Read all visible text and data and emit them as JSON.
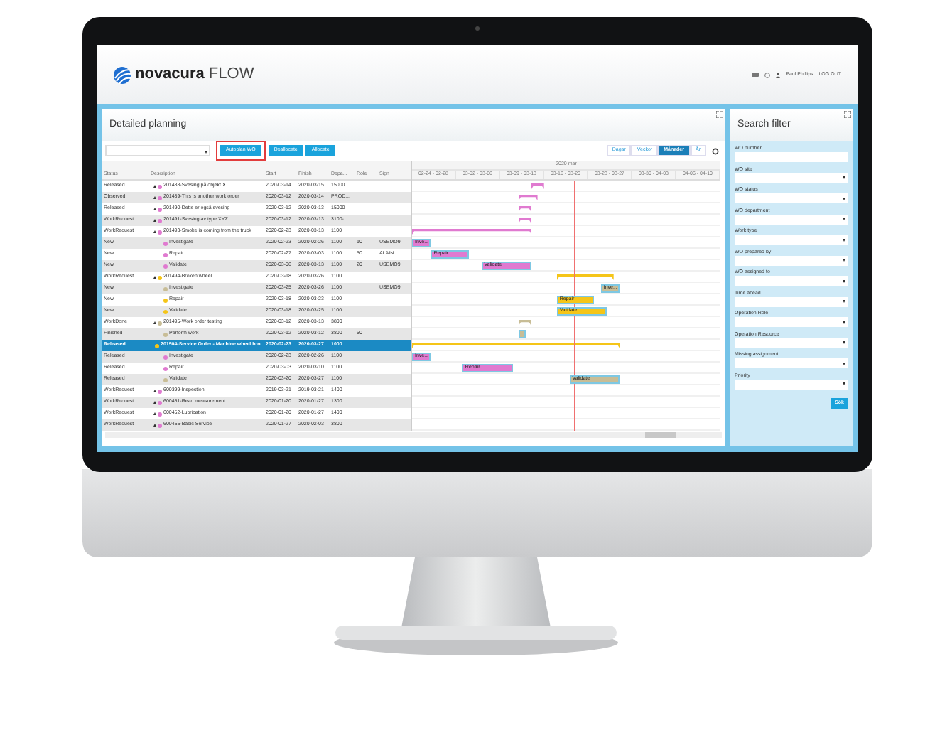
{
  "header": {
    "logo_name": "novacura",
    "logo_product": "FLOW",
    "user": "Paul Phillips",
    "logout": "LOG OUT"
  },
  "planning": {
    "title": "Detailed planning",
    "buttons": [
      {
        "label": "Autoplan WO",
        "highlighted": true
      },
      {
        "label": "Deallocate",
        "highlighted": false
      },
      {
        "label": "Allocate",
        "highlighted": false
      }
    ],
    "view_modes": [
      {
        "label": "Dagar",
        "selected": false
      },
      {
        "label": "Veckor",
        "selected": false
      },
      {
        "label": "Månader",
        "selected": true
      },
      {
        "label": "År",
        "selected": false
      }
    ],
    "columns": [
      "Status",
      "Description",
      "Start",
      "Finish",
      "Depa...",
      "Role",
      "Sign"
    ],
    "rows": [
      {
        "status": "Released",
        "description": "201488-Svesing på objekt X",
        "start": "2020-03-14",
        "finish": "2020-03-15",
        "dept": "15000",
        "color": "#e07ad0",
        "selected": false
      },
      {
        "status": "Observed",
        "description": "201489-This is another work order",
        "start": "2020-03-12",
        "finish": "2020-03-14",
        "dept": "PROD...",
        "color": "#e07ad0",
        "selected": false
      },
      {
        "status": "Released",
        "description": "201490-Dette er også svesing",
        "start": "2020-03-12",
        "finish": "2020-03-13",
        "dept": "15000",
        "color": "#e07ad0",
        "selected": false
      },
      {
        "status": "WorkRequest",
        "description": "201491-Svesing av type XYZ",
        "start": "2020-03-12",
        "finish": "2020-03-13",
        "dept": "3100-...",
        "color": "#e07ad0",
        "selected": false
      },
      {
        "status": "WorkRequest",
        "description": "201493-Smoke is coming from the truck",
        "start": "2020-02-23",
        "finish": "2020-03-13",
        "dept": "1100",
        "color": "#e07ad0",
        "selected": false,
        "children": [
          {
            "status": "New",
            "description": "Investigate",
            "start": "2020-02-23",
            "finish": "2020-02-26",
            "dept": "1100",
            "role": "10",
            "sign": "USEMO9",
            "color": "#e07ad0",
            "bar_label": "Inve...",
            "selected": false
          },
          {
            "status": "New",
            "description": "Repair",
            "start": "2020-02-27",
            "finish": "2020-03-03",
            "dept": "1100",
            "role": "50",
            "sign": "ALAIN",
            "color": "#e07ad0",
            "bar_label": "Repair",
            "selected": false
          },
          {
            "status": "New",
            "description": "Validate",
            "start": "2020-03-06",
            "finish": "2020-03-13",
            "dept": "1100",
            "role": "20",
            "sign": "USEMO9",
            "color": "#e07ad0",
            "bar_label": "Validate",
            "selected": false
          }
        ]
      },
      {
        "status": "WorkRequest",
        "description": "201494-Broken wheel",
        "start": "2020-03-18",
        "finish": "2020-03-26",
        "dept": "1100",
        "color": "#f5c518",
        "selected": false,
        "children": [
          {
            "status": "New",
            "description": "Investigate",
            "start": "2020-03-25",
            "finish": "2020-03-26",
            "dept": "1100",
            "sign": "USEMO9",
            "color": "#c8bd96",
            "bar_label": "Inve...",
            "selected": false
          },
          {
            "status": "New",
            "description": "Repair",
            "start": "2020-03-18",
            "finish": "2020-03-23",
            "dept": "1100",
            "color": "#f5c518",
            "bar_label": "Repair",
            "selected": false
          },
          {
            "status": "New",
            "description": "Validate",
            "start": "2020-03-18",
            "finish": "2020-03-25",
            "dept": "1100",
            "color": "#f5c518",
            "bar_label": "Validate",
            "selected": false
          }
        ]
      },
      {
        "status": "WorkDone",
        "description": "201495-Work order testing",
        "start": "2020-03-12",
        "finish": "2020-03-13",
        "dept": "3800",
        "color": "#c8bd96",
        "selected": false,
        "children": [
          {
            "status": "Finished",
            "description": "Perform work",
            "start": "2020-03-12",
            "finish": "2020-03-12",
            "dept": "3800",
            "role": "50",
            "color": "#c8bd96",
            "selected": false
          }
        ]
      },
      {
        "status": "Released",
        "description": "201504-Service Order - Machine wheel bro...",
        "start": "2020-02-23",
        "finish": "2020-03-27",
        "dept": "1000",
        "color": "#f5c518",
        "selected": true,
        "children": [
          {
            "status": "Released",
            "description": "Investigate",
            "start": "2020-02-23",
            "finish": "2020-02-26",
            "dept": "1100",
            "color": "#e07ad0",
            "bar_label": "Inve...",
            "selected": false
          },
          {
            "status": "Released",
            "description": "Repair",
            "start": "2020-03-03",
            "finish": "2020-03-10",
            "dept": "1100",
            "color": "#e07ad0",
            "bar_label": "Repair",
            "selected": false
          },
          {
            "status": "Released",
            "description": "Validate",
            "start": "2020-03-20",
            "finish": "2020-03-27",
            "dept": "1100",
            "color": "#c8bd96",
            "bar_label": "Validate",
            "selected": false
          }
        ]
      },
      {
        "status": "WorkRequest",
        "description": "600399-Inspection",
        "start": "2019-03-21",
        "finish": "2019-03-21",
        "dept": "1400",
        "color": "#e07ad0",
        "selected": false
      },
      {
        "status": "WorkRequest",
        "description": "600451-Read measurement",
        "start": "2020-01-20",
        "finish": "2020-01-27",
        "dept": "1300",
        "color": "#e07ad0",
        "selected": false
      },
      {
        "status": "WorkRequest",
        "description": "600452-Lubrication",
        "start": "2020-01-20",
        "finish": "2020-01-27",
        "dept": "1400",
        "color": "#e07ad0",
        "selected": false
      },
      {
        "status": "WorkRequest",
        "description": "600455-Basic Service",
        "start": "2020-01-27",
        "finish": "2020-02-03",
        "dept": "3800",
        "color": "#e07ad0",
        "selected": false
      }
    ],
    "gantt_month": "2020 mar",
    "gantt_weeks": [
      "02-24 - 02-28",
      "03-02 - 03-06",
      "03-09 - 03-13",
      "03-16 - 03-20",
      "03-23 - 03-27",
      "03-30 - 04-03",
      "04-06 - 04-10"
    ]
  },
  "filter": {
    "title": "Search filter",
    "fields": [
      {
        "label": "WO number",
        "kind": "text"
      },
      {
        "label": "WO site",
        "kind": "select"
      },
      {
        "label": "WO status",
        "kind": "select"
      },
      {
        "label": "WO department",
        "kind": "select"
      },
      {
        "label": "Work type",
        "kind": "select"
      },
      {
        "label": "WO prepared by",
        "kind": "select"
      },
      {
        "label": "WO assigned to",
        "kind": "select"
      },
      {
        "label": "Time ahead",
        "kind": "select"
      },
      {
        "label": "Operation Role",
        "kind": "select"
      },
      {
        "label": "Operation Resource",
        "kind": "select"
      },
      {
        "label": "Missing assignment",
        "kind": "select"
      },
      {
        "label": "Priority",
        "kind": "select"
      }
    ],
    "button": "Sök"
  }
}
